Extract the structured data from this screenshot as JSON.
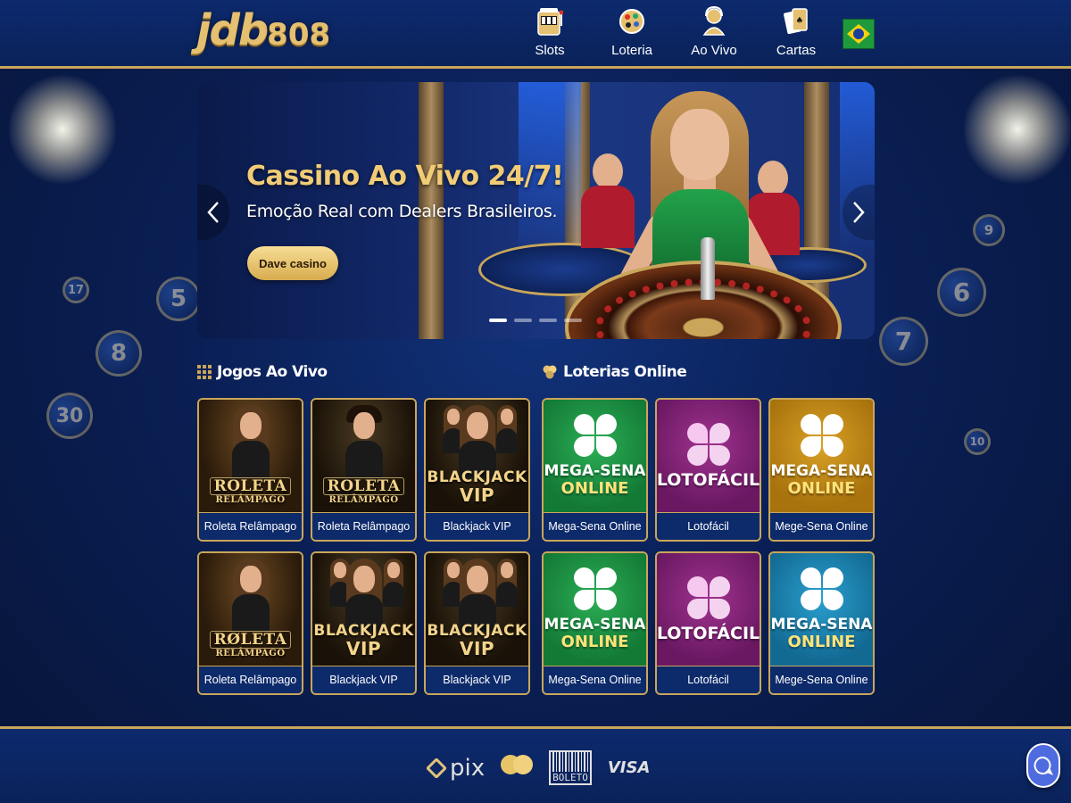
{
  "brand": {
    "logo_main": "jdb",
    "logo_num": "808"
  },
  "nav": [
    {
      "label": "Slots",
      "icon": "slot-machine-icon"
    },
    {
      "label": "Loteria",
      "icon": "lottery-ball-icon"
    },
    {
      "label": "Ao Vivo",
      "icon": "live-dealer-icon"
    },
    {
      "label": "Cartas",
      "icon": "playing-cards-icon"
    }
  ],
  "language_flag": "brazil-flag-icon",
  "hero": {
    "title": "Cassino Ao Vivo 24/7!",
    "subtitle": "Emoção Real com Dealers Brasileiros.",
    "cta": "Dave casino",
    "slides": 4,
    "active_slide": 1
  },
  "live_section": {
    "title": "Jogos Ao Vivo",
    "games": [
      {
        "caption": "Roleta Relâmpago",
        "logo1": "ROLETA",
        "logo2": "RELÂMPAGO",
        "kind": "roleta",
        "person": "woman"
      },
      {
        "caption": "Roleta Relâmpago",
        "logo1": "ROLETA",
        "logo2": "RELÂMPAGO",
        "kind": "roleta",
        "person": "man"
      },
      {
        "caption": "Blackjack VIP",
        "logo1": "BLACKJACK",
        "logo2": "VIP",
        "kind": "blackjack",
        "person": "woman"
      },
      {
        "caption": "Roleta Relâmpago",
        "logo1": "RØLETA",
        "logo2": "RELÂMPAGO",
        "kind": "roleta",
        "person": "woman"
      },
      {
        "caption": "Blackjack VIP",
        "logo1": "BLACKJACK",
        "logo2": "VIP",
        "kind": "blackjack",
        "person": "woman"
      },
      {
        "caption": "Blackjack VIP",
        "logo1": "BLACKJACK",
        "logo2": "VIP",
        "kind": "blackjack",
        "person": "woman"
      }
    ]
  },
  "lottery_section": {
    "title": "Loterias Online",
    "games": [
      {
        "caption": "Mega-Sena Online",
        "name1": "MEGA-SENA",
        "name2": "ONLINE",
        "color": "green"
      },
      {
        "caption": "Lotofácil",
        "name1": "LOTOFÁCIL",
        "name2": "",
        "color": "purple"
      },
      {
        "caption": "Mege-Sena Online",
        "name1": "MEGA-SENA",
        "name2": "ONLINE",
        "color": "gold"
      },
      {
        "caption": "Mega-Sena Online",
        "name1": "MEGA-SENA",
        "name2": "ONLINE",
        "color": "green"
      },
      {
        "caption": "Lotofácil",
        "name1": "LOTOFÁCIL",
        "name2": "",
        "color": "purple"
      },
      {
        "caption": "Mege-Sena Online",
        "name1": "MEGA-SENA",
        "name2": "ONLINE",
        "color": "teal"
      }
    ]
  },
  "footer": {
    "payments": [
      {
        "name": "pix",
        "label": "pix"
      },
      {
        "name": "mastercard",
        "label": ""
      },
      {
        "name": "boleto",
        "label": "BOLETO"
      },
      {
        "name": "visa",
        "label": "VISA"
      }
    ]
  },
  "colors": {
    "gold": "#c9a65a",
    "navy": "#0a2259",
    "accent_text": "#f1cc76",
    "chat": "#4f6be0"
  }
}
